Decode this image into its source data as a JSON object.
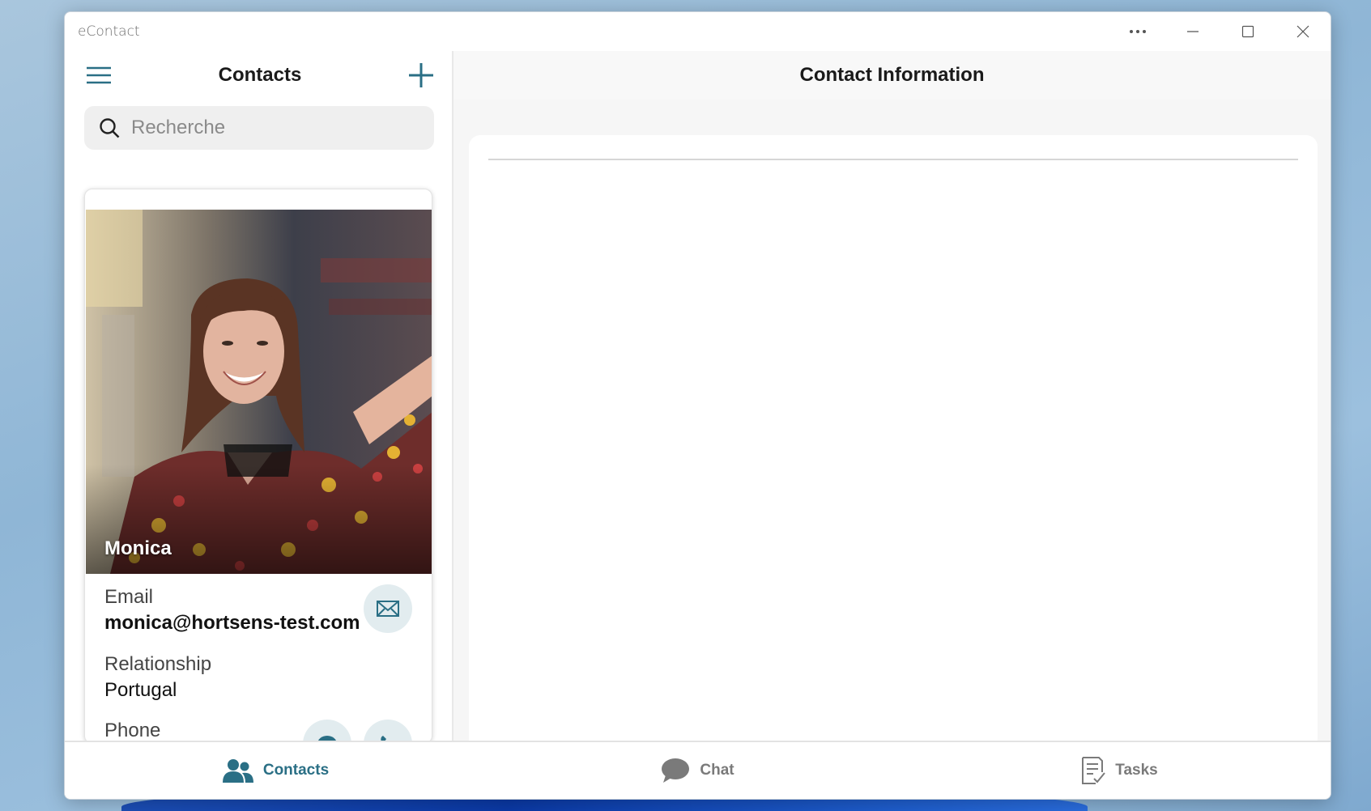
{
  "window": {
    "title": "eContact",
    "controls": [
      "more",
      "minimize",
      "maximize",
      "close"
    ]
  },
  "left": {
    "title": "Contacts",
    "search": {
      "placeholder": "Recherche",
      "value": ""
    }
  },
  "contact_card": {
    "name": "Monica",
    "email_label": "Email",
    "email_value": "monica@hortsens-test.com",
    "relationship_label": "Relationship",
    "relationship_value": "Portugal",
    "phone_label": "Phone"
  },
  "right": {
    "title": "Contact Information"
  },
  "tabs": [
    {
      "label": "Contacts",
      "icon": "people-icon",
      "active": true
    },
    {
      "label": "Chat",
      "icon": "chat-icon",
      "active": false
    },
    {
      "label": "Tasks",
      "icon": "tasks-icon",
      "active": false
    }
  ],
  "colors": {
    "accent": "#2a6f85",
    "inactive": "#7a7a7a"
  }
}
